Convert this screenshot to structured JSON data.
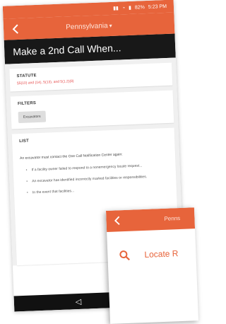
{
  "colors": {
    "accent": "#e7643b",
    "title_bar": "#181818",
    "statute_text": "#e64a4a",
    "background": "#f0f0f0"
  },
  "status_bar": {
    "time": "5:23 PM",
    "battery": "82%"
  },
  "header": {
    "back_icon": "chevron-left-icon",
    "title": "Pennsylvania",
    "dropdown_icon": "chevron-down-icon"
  },
  "page_title": "Make a 2nd Call When...",
  "statute": {
    "heading": "STATUTE",
    "text": "§5(10) and (14), 5(13), and 5(1.2)(8)"
  },
  "filters": {
    "heading": "FILTERS",
    "chip": "Excavators"
  },
  "list": {
    "heading": "LIST",
    "intro": "An excavator must contact the One Call Notification Center again:",
    "items": [
      "If a facility owner failed to respond to a nonemergency locate request...",
      "An excavator has identified incorrectly marked facilities or responsibilities.",
      "In the event that facilities..."
    ]
  },
  "nav": {
    "back_icon": "nav-back-icon"
  },
  "front_screen": {
    "back_icon": "chevron-left-icon",
    "title": "Penns",
    "item_icon": "search-icon",
    "item_label": "Locate R"
  }
}
